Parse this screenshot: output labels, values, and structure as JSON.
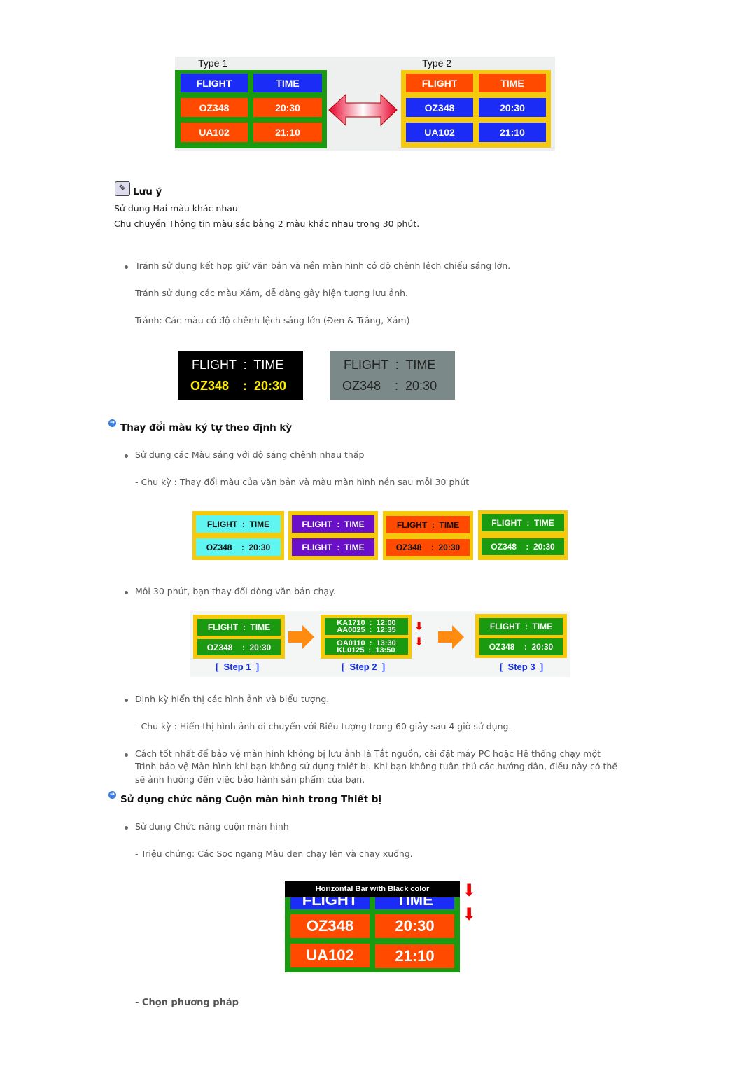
{
  "fig1": {
    "type1": "Type 1",
    "type2": "Type 2",
    "flight": "FLIGHT",
    "time": "TIME",
    "r1a": "OZ348",
    "r1b": "20:30",
    "r2a": "UA102",
    "r2b": "21:10",
    "arrow_icon": "double-arrow-icon"
  },
  "note": {
    "icon": "note-icon",
    "title": "Lưu ý",
    "line1": "Sử dụng Hai màu khác nhau",
    "line2": "Chu chuyển Thông tin màu sắc bằng 2 màu khác nhau trong 30 phút."
  },
  "avoid": {
    "b1": "Tránh sử dụng kết hợp giữ văn bản và nền màn hình có độ chênh lệch chiếu sáng lớn.",
    "p1": "Tránh sử dụng các màu Xám, dễ dàng gây hiện tượng lưu ảnh.",
    "p2": "Tránh: Các màu có độ chênh lệch sáng lớn (Đen & Trắng, Xám)"
  },
  "fig2": {
    "l1": "FLIGHT  :  TIME",
    "l2": "OZ348    :  20:30"
  },
  "sec1": {
    "title": "Thay đổi màu ký tự theo định kỳ",
    "b1": "Sử dụng các Màu sáng với độ sáng chênh nhau thấp",
    "p1": "- Chu kỳ : Thay đổi màu của văn bản và màu màn hình nền sau mỗi 30 phút"
  },
  "fig3": {
    "ft": "FLIGHT  :  TIME",
    "oz": "OZ348    :  20:30"
  },
  "sec1b": {
    "b2": "Mỗi 30 phút, bạn thay đổi dòng văn bản chạy."
  },
  "fig4": {
    "step1": "[  Step 1  ]",
    "step2": "[  Step 2  ]",
    "step3": "[  Step 3  ]",
    "s2a": "KA1710  :  12:00\nAA0025  :  12:35",
    "s2b": "OA0110  :  13:30\nKL0125  :  13:50"
  },
  "sec1c": {
    "b3": "Định kỳ hiển thị các hình ảnh và biểu tượng.",
    "p3": "- Chu kỳ : Hiển thị hình ảnh di chuyển với Biểu tượng trong 60 giây sau 4 giờ sử dụng.",
    "b4a": "Cách tốt nhất để bảo vệ màn hình không bị lưu ảnh là Tắt nguồn, cài đặt máy PC hoặc Hệ thống chạy một",
    "b4b": "Trình bảo vệ Màn hình khi bạn không sử dụng thiết bị. Khi bạn không tuân thủ các hướng dẫn, điều này có thể",
    "b4c": "sẽ ảnh hưởng đến việc bảo hành sản phẩm của bạn."
  },
  "sec2": {
    "title": "Sử dụng chức năng Cuộn màn hình trong Thiết bị",
    "b1": "Sử dụng Chức năng cuộn màn hình",
    "p1": "- Triệu chứng: Các Sọc ngang Màu đen chạy lên và chạy xuống.",
    "method": "- Chọn phương pháp"
  },
  "fig5": {
    "bar": "Horizontal Bar with Black color"
  }
}
